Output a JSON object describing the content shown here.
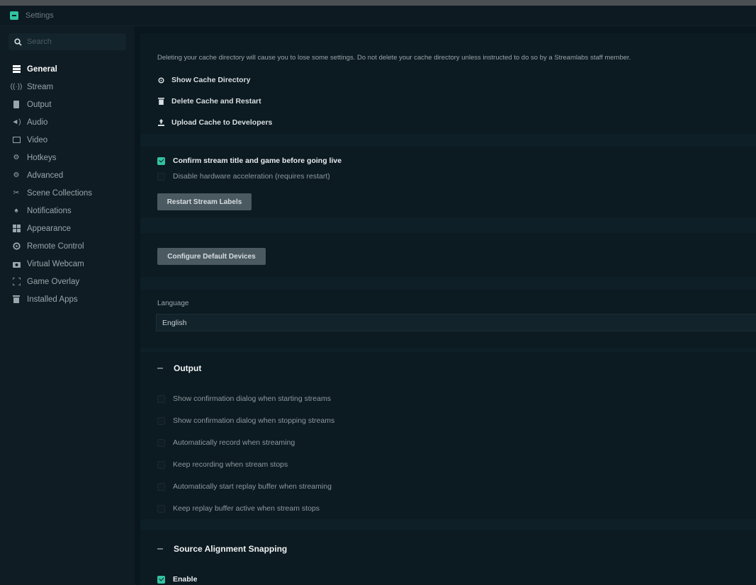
{
  "window": {
    "title": "Settings"
  },
  "sidebar": {
    "search_placeholder": "Search",
    "items": [
      {
        "label": "General",
        "icon": "general-icon",
        "active": true
      },
      {
        "label": "Stream",
        "icon": "stream-icon"
      },
      {
        "label": "Output",
        "icon": "output-icon"
      },
      {
        "label": "Audio",
        "icon": "audio-icon"
      },
      {
        "label": "Video",
        "icon": "video-icon"
      },
      {
        "label": "Hotkeys",
        "icon": "hotkeys-icon"
      },
      {
        "label": "Advanced",
        "icon": "advanced-icon"
      },
      {
        "label": "Scene Collections",
        "icon": "scene-collections-icon"
      },
      {
        "label": "Notifications",
        "icon": "notifications-icon"
      },
      {
        "label": "Appearance",
        "icon": "appearance-icon"
      },
      {
        "label": "Remote Control",
        "icon": "remote-control-icon"
      },
      {
        "label": "Virtual Webcam",
        "icon": "webcam-icon"
      },
      {
        "label": "Game Overlay",
        "icon": "game-overlay-icon"
      },
      {
        "label": "Installed Apps",
        "icon": "installed-apps-icon"
      }
    ]
  },
  "cache": {
    "warning": "Deleting your cache directory will cause you to lose some settings. Do not delete your cache directory unless instructed to do so by a Streamlabs staff member.",
    "show_cache": "Show Cache Directory",
    "delete_cache": "Delete Cache and Restart",
    "upload_cache": "Upload Cache to Developers"
  },
  "misc": {
    "confirm_title": "Confirm stream title and game before going live",
    "confirm_title_checked": true,
    "disable_hw": "Disable hardware acceleration (requires restart)",
    "disable_hw_checked": false,
    "restart_labels_button": "Restart Stream Labels"
  },
  "devices": {
    "configure_button": "Configure Default Devices"
  },
  "language": {
    "label": "Language",
    "value": "English"
  },
  "output": {
    "header": "Output",
    "options": [
      {
        "label": "Show confirmation dialog when starting streams",
        "checked": false
      },
      {
        "label": "Show confirmation dialog when stopping streams",
        "checked": false
      },
      {
        "label": "Automatically record when streaming",
        "checked": false
      },
      {
        "label": "Keep recording when stream stops",
        "checked": false
      },
      {
        "label": "Automatically start replay buffer when streaming",
        "checked": false
      },
      {
        "label": "Keep replay buffer active when stream stops",
        "checked": false
      }
    ]
  },
  "snapping": {
    "header": "Source Alignment Snapping",
    "enable_label": "Enable",
    "enable_checked": true
  },
  "colors": {
    "accent": "#31c3a2",
    "background": "#09161d",
    "sidebar": "#0f1c23"
  }
}
